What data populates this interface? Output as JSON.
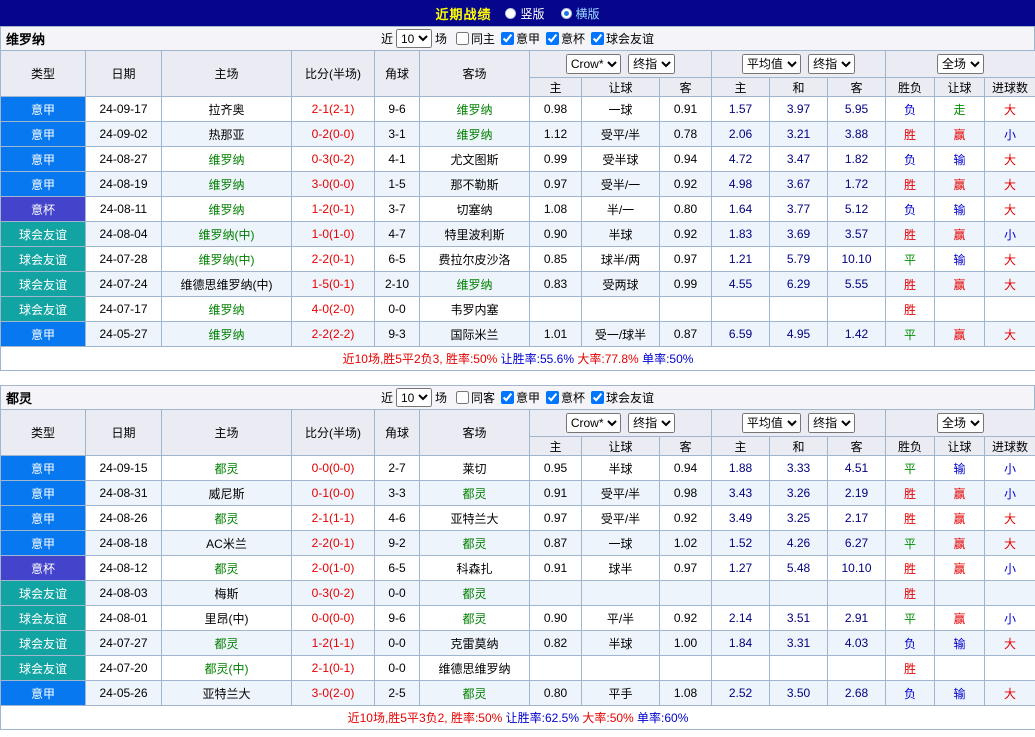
{
  "title_bar": {
    "title": "近期战绩",
    "radios": [
      {
        "label": "竖版",
        "selected": false
      },
      {
        "label": "横版",
        "selected": true
      }
    ]
  },
  "palette": {
    "seriea": "#0778F0",
    "coppa": "#4343CB",
    "friendly": "#12A3A3"
  },
  "status_colors": {
    "red": "#E60000",
    "blue": "#0000D0",
    "green": "#009000",
    "none": "#000000"
  },
  "colors": {
    "focus_team": "#008000",
    "score": "#E60000",
    "avg_odds": "#000080"
  },
  "sections": [
    {
      "team": "维罗纳",
      "controls": {
        "near": "近",
        "count": "10",
        "unit": "场",
        "filters": [
          {
            "label": "同主",
            "checked": false
          },
          {
            "label": "意甲",
            "checked": true
          },
          {
            "label": "意杯",
            "checked": true
          },
          {
            "label": "球会友谊",
            "checked": true
          }
        ]
      },
      "header": {
        "col_type": "类型",
        "col_date": "日期",
        "col_home": "主场",
        "col_score": "比分(半场)",
        "col_corner": "角球",
        "col_away": "客场",
        "odds_source": "Crow*",
        "odds_stage": "终指",
        "avg_source": "平均值",
        "avg_stage": "终指",
        "scope": "全场",
        "sub": [
          "主",
          "让球",
          "客",
          "主",
          "和",
          "客",
          "胜负",
          "让球",
          "进球数"
        ]
      },
      "rows": [
        {
          "league": "意甲",
          "league_key": "seriea",
          "date": "24-09-17",
          "home": "拉齐奥",
          "home_focus": false,
          "score": "2-1(2-1)",
          "corner": "9-6",
          "away": "维罗纳",
          "away_focus": true,
          "odds": [
            "0.98",
            "一球",
            "0.91"
          ],
          "avg": [
            "1.57",
            "3.97",
            "5.95"
          ],
          "result": {
            "t": "负",
            "c": "blue"
          },
          "asian": {
            "t": "走",
            "c": "green"
          },
          "goals": {
            "t": "大",
            "c": "red"
          }
        },
        {
          "league": "意甲",
          "league_key": "seriea",
          "date": "24-09-02",
          "home": "热那亚",
          "home_focus": false,
          "score": "0-2(0-0)",
          "corner": "3-1",
          "away": "维罗纳",
          "away_focus": true,
          "odds": [
            "1.12",
            "受平/半",
            "0.78"
          ],
          "avg": [
            "2.06",
            "3.21",
            "3.88"
          ],
          "result": {
            "t": "胜",
            "c": "red"
          },
          "asian": {
            "t": "赢",
            "c": "red"
          },
          "goals": {
            "t": "小",
            "c": "blue"
          }
        },
        {
          "league": "意甲",
          "league_key": "seriea",
          "date": "24-08-27",
          "home": "维罗纳",
          "home_focus": true,
          "score": "0-3(0-2)",
          "corner": "4-1",
          "away": "尤文图斯",
          "away_focus": false,
          "odds": [
            "0.99",
            "受半球",
            "0.94"
          ],
          "avg": [
            "4.72",
            "3.47",
            "1.82"
          ],
          "result": {
            "t": "负",
            "c": "blue"
          },
          "asian": {
            "t": "输",
            "c": "blue"
          },
          "goals": {
            "t": "大",
            "c": "red"
          }
        },
        {
          "league": "意甲",
          "league_key": "seriea",
          "date": "24-08-19",
          "home": "维罗纳",
          "home_focus": true,
          "score": "3-0(0-0)",
          "corner": "1-5",
          "away": "那不勒斯",
          "away_focus": false,
          "odds": [
            "0.97",
            "受半/一",
            "0.92"
          ],
          "avg": [
            "4.98",
            "3.67",
            "1.72"
          ],
          "result": {
            "t": "胜",
            "c": "red"
          },
          "asian": {
            "t": "赢",
            "c": "red"
          },
          "goals": {
            "t": "大",
            "c": "red"
          }
        },
        {
          "league": "意杯",
          "league_key": "coppa",
          "date": "24-08-11",
          "home": "维罗纳",
          "home_focus": true,
          "score": "1-2(0-1)",
          "corner": "3-7",
          "away": "切塞纳",
          "away_focus": false,
          "odds": [
            "1.08",
            "半/一",
            "0.80"
          ],
          "avg": [
            "1.64",
            "3.77",
            "5.12"
          ],
          "result": {
            "t": "负",
            "c": "blue"
          },
          "asian": {
            "t": "输",
            "c": "blue"
          },
          "goals": {
            "t": "大",
            "c": "red"
          }
        },
        {
          "league": "球会友谊",
          "league_key": "friendly",
          "date": "24-08-04",
          "home": "维罗纳(中)",
          "home_focus": true,
          "score": "1-0(1-0)",
          "corner": "4-7",
          "away": "特里波利斯",
          "away_focus": false,
          "odds": [
            "0.90",
            "半球",
            "0.92"
          ],
          "avg": [
            "1.83",
            "3.69",
            "3.57"
          ],
          "result": {
            "t": "胜",
            "c": "red"
          },
          "asian": {
            "t": "赢",
            "c": "red"
          },
          "goals": {
            "t": "小",
            "c": "blue"
          }
        },
        {
          "league": "球会友谊",
          "league_key": "friendly",
          "date": "24-07-28",
          "home": "维罗纳(中)",
          "home_focus": true,
          "score": "2-2(0-1)",
          "corner": "6-5",
          "away": "费拉尔皮沙洛",
          "away_focus": false,
          "odds": [
            "0.85",
            "球半/两",
            "0.97"
          ],
          "avg": [
            "1.21",
            "5.79",
            "10.10"
          ],
          "result": {
            "t": "平",
            "c": "green"
          },
          "asian": {
            "t": "输",
            "c": "blue"
          },
          "goals": {
            "t": "大",
            "c": "red"
          }
        },
        {
          "league": "球会友谊",
          "league_key": "friendly",
          "date": "24-07-24",
          "home": "维德思维罗纳(中)",
          "home_focus": false,
          "score": "1-5(0-1)",
          "corner": "2-10",
          "away": "维罗纳",
          "away_focus": true,
          "odds": [
            "0.83",
            "受两球",
            "0.99"
          ],
          "avg": [
            "4.55",
            "6.29",
            "5.55"
          ],
          "result": {
            "t": "胜",
            "c": "red"
          },
          "asian": {
            "t": "赢",
            "c": "red"
          },
          "goals": {
            "t": "大",
            "c": "red"
          }
        },
        {
          "league": "球会友谊",
          "league_key": "friendly",
          "date": "24-07-17",
          "home": "维罗纳",
          "home_focus": true,
          "score": "4-0(2-0)",
          "corner": "0-0",
          "away": "韦罗内塞",
          "away_focus": false,
          "odds": [
            "",
            "",
            ""
          ],
          "avg": [
            "",
            "",
            ""
          ],
          "result": {
            "t": "胜",
            "c": "red"
          },
          "asian": {
            "t": "",
            "c": "none"
          },
          "goals": {
            "t": "",
            "c": "none"
          }
        },
        {
          "league": "意甲",
          "league_key": "seriea",
          "date": "24-05-27",
          "home": "维罗纳",
          "home_focus": true,
          "score": "2-2(2-2)",
          "corner": "9-3",
          "away": "国际米兰",
          "away_focus": false,
          "odds": [
            "1.01",
            "受一/球半",
            "0.87"
          ],
          "avg": [
            "6.59",
            "4.95",
            "1.42"
          ],
          "result": {
            "t": "平",
            "c": "green"
          },
          "asian": {
            "t": "赢",
            "c": "red"
          },
          "goals": {
            "t": "大",
            "c": "red"
          }
        }
      ],
      "summary": [
        {
          "text": "近10场,胜5平2负3, 胜率:50%",
          "color": "red"
        },
        {
          "text": " 让胜率:55.6%",
          "color": "blue"
        },
        {
          "text": " 大率:77.8%",
          "color": "red"
        },
        {
          "text": " 单率:50%",
          "color": "blue"
        }
      ]
    },
    {
      "team": "都灵",
      "controls": {
        "near": "近",
        "count": "10",
        "unit": "场",
        "filters": [
          {
            "label": "同客",
            "checked": false
          },
          {
            "label": "意甲",
            "checked": true
          },
          {
            "label": "意杯",
            "checked": true
          },
          {
            "label": "球会友谊",
            "checked": true
          }
        ]
      },
      "header": {
        "col_type": "类型",
        "col_date": "日期",
        "col_home": "主场",
        "col_score": "比分(半场)",
        "col_corner": "角球",
        "col_away": "客场",
        "odds_source": "Crow*",
        "odds_stage": "终指",
        "avg_source": "平均值",
        "avg_stage": "终指",
        "scope": "全场",
        "sub": [
          "主",
          "让球",
          "客",
          "主",
          "和",
          "客",
          "胜负",
          "让球",
          "进球数"
        ]
      },
      "rows": [
        {
          "league": "意甲",
          "league_key": "seriea",
          "date": "24-09-15",
          "home": "都灵",
          "home_focus": true,
          "score": "0-0(0-0)",
          "corner": "2-7",
          "away": "莱切",
          "away_focus": false,
          "odds": [
            "0.95",
            "半球",
            "0.94"
          ],
          "avg": [
            "1.88",
            "3.33",
            "4.51"
          ],
          "result": {
            "t": "平",
            "c": "green"
          },
          "asian": {
            "t": "输",
            "c": "blue"
          },
          "goals": {
            "t": "小",
            "c": "blue"
          }
        },
        {
          "league": "意甲",
          "league_key": "seriea",
          "date": "24-08-31",
          "home": "威尼斯",
          "home_focus": false,
          "score": "0-1(0-0)",
          "corner": "3-3",
          "away": "都灵",
          "away_focus": true,
          "odds": [
            "0.91",
            "受平/半",
            "0.98"
          ],
          "avg": [
            "3.43",
            "3.26",
            "2.19"
          ],
          "result": {
            "t": "胜",
            "c": "red"
          },
          "asian": {
            "t": "赢",
            "c": "red"
          },
          "goals": {
            "t": "小",
            "c": "blue"
          }
        },
        {
          "league": "意甲",
          "league_key": "seriea",
          "date": "24-08-26",
          "home": "都灵",
          "home_focus": true,
          "score": "2-1(1-1)",
          "corner": "4-6",
          "away": "亚特兰大",
          "away_focus": false,
          "odds": [
            "0.97",
            "受平/半",
            "0.92"
          ],
          "avg": [
            "3.49",
            "3.25",
            "2.17"
          ],
          "result": {
            "t": "胜",
            "c": "red"
          },
          "asian": {
            "t": "赢",
            "c": "red"
          },
          "goals": {
            "t": "大",
            "c": "red"
          }
        },
        {
          "league": "意甲",
          "league_key": "seriea",
          "date": "24-08-18",
          "home": "AC米兰",
          "home_focus": false,
          "score": "2-2(0-1)",
          "corner": "9-2",
          "away": "都灵",
          "away_focus": true,
          "odds": [
            "0.87",
            "一球",
            "1.02"
          ],
          "avg": [
            "1.52",
            "4.26",
            "6.27"
          ],
          "result": {
            "t": "平",
            "c": "green"
          },
          "asian": {
            "t": "赢",
            "c": "red"
          },
          "goals": {
            "t": "大",
            "c": "red"
          }
        },
        {
          "league": "意杯",
          "league_key": "coppa",
          "date": "24-08-12",
          "home": "都灵",
          "home_focus": true,
          "score": "2-0(1-0)",
          "corner": "6-5",
          "away": "科森扎",
          "away_focus": false,
          "odds": [
            "0.91",
            "球半",
            "0.97"
          ],
          "avg": [
            "1.27",
            "5.48",
            "10.10"
          ],
          "result": {
            "t": "胜",
            "c": "red"
          },
          "asian": {
            "t": "赢",
            "c": "red"
          },
          "goals": {
            "t": "小",
            "c": "blue"
          }
        },
        {
          "league": "球会友谊",
          "league_key": "friendly",
          "date": "24-08-03",
          "home": "梅斯",
          "home_focus": false,
          "score": "0-3(0-2)",
          "corner": "0-0",
          "away": "都灵",
          "away_focus": true,
          "odds": [
            "",
            "",
            ""
          ],
          "avg": [
            "",
            "",
            ""
          ],
          "result": {
            "t": "胜",
            "c": "red"
          },
          "asian": {
            "t": "",
            "c": "none"
          },
          "goals": {
            "t": "",
            "c": "none"
          }
        },
        {
          "league": "球会友谊",
          "league_key": "friendly",
          "date": "24-08-01",
          "home": "里昂(中)",
          "home_focus": false,
          "score": "0-0(0-0)",
          "corner": "9-6",
          "away": "都灵",
          "away_focus": true,
          "odds": [
            "0.90",
            "平/半",
            "0.92"
          ],
          "avg": [
            "2.14",
            "3.51",
            "2.91"
          ],
          "result": {
            "t": "平",
            "c": "green"
          },
          "asian": {
            "t": "赢",
            "c": "red"
          },
          "goals": {
            "t": "小",
            "c": "blue"
          }
        },
        {
          "league": "球会友谊",
          "league_key": "friendly",
          "date": "24-07-27",
          "home": "都灵",
          "home_focus": true,
          "score": "1-2(1-1)",
          "corner": "0-0",
          "away": "克雷莫纳",
          "away_focus": false,
          "odds": [
            "0.82",
            "半球",
            "1.00"
          ],
          "avg": [
            "1.84",
            "3.31",
            "4.03"
          ],
          "result": {
            "t": "负",
            "c": "blue"
          },
          "asian": {
            "t": "输",
            "c": "blue"
          },
          "goals": {
            "t": "大",
            "c": "red"
          }
        },
        {
          "league": "球会友谊",
          "league_key": "friendly",
          "date": "24-07-20",
          "home": "都灵(中)",
          "home_focus": true,
          "score": "2-1(0-1)",
          "corner": "0-0",
          "away": "维德思维罗纳",
          "away_focus": false,
          "odds": [
            "",
            "",
            ""
          ],
          "avg": [
            "",
            "",
            ""
          ],
          "result": {
            "t": "胜",
            "c": "red"
          },
          "asian": {
            "t": "",
            "c": "none"
          },
          "goals": {
            "t": "",
            "c": "none"
          }
        },
        {
          "league": "意甲",
          "league_key": "seriea",
          "date": "24-05-26",
          "home": "亚特兰大",
          "home_focus": false,
          "score": "3-0(2-0)",
          "corner": "2-5",
          "away": "都灵",
          "away_focus": true,
          "odds": [
            "0.80",
            "平手",
            "1.08"
          ],
          "avg": [
            "2.52",
            "3.50",
            "2.68"
          ],
          "result": {
            "t": "负",
            "c": "blue"
          },
          "asian": {
            "t": "输",
            "c": "blue"
          },
          "goals": {
            "t": "大",
            "c": "red"
          }
        }
      ],
      "summary": [
        {
          "text": "近10场,胜5平3负2, 胜率:50%",
          "color": "red"
        },
        {
          "text": " 让胜率:62.5%",
          "color": "blue"
        },
        {
          "text": " 大率:50%",
          "color": "red"
        },
        {
          "text": " 单率:60%",
          "color": "blue"
        }
      ]
    }
  ]
}
